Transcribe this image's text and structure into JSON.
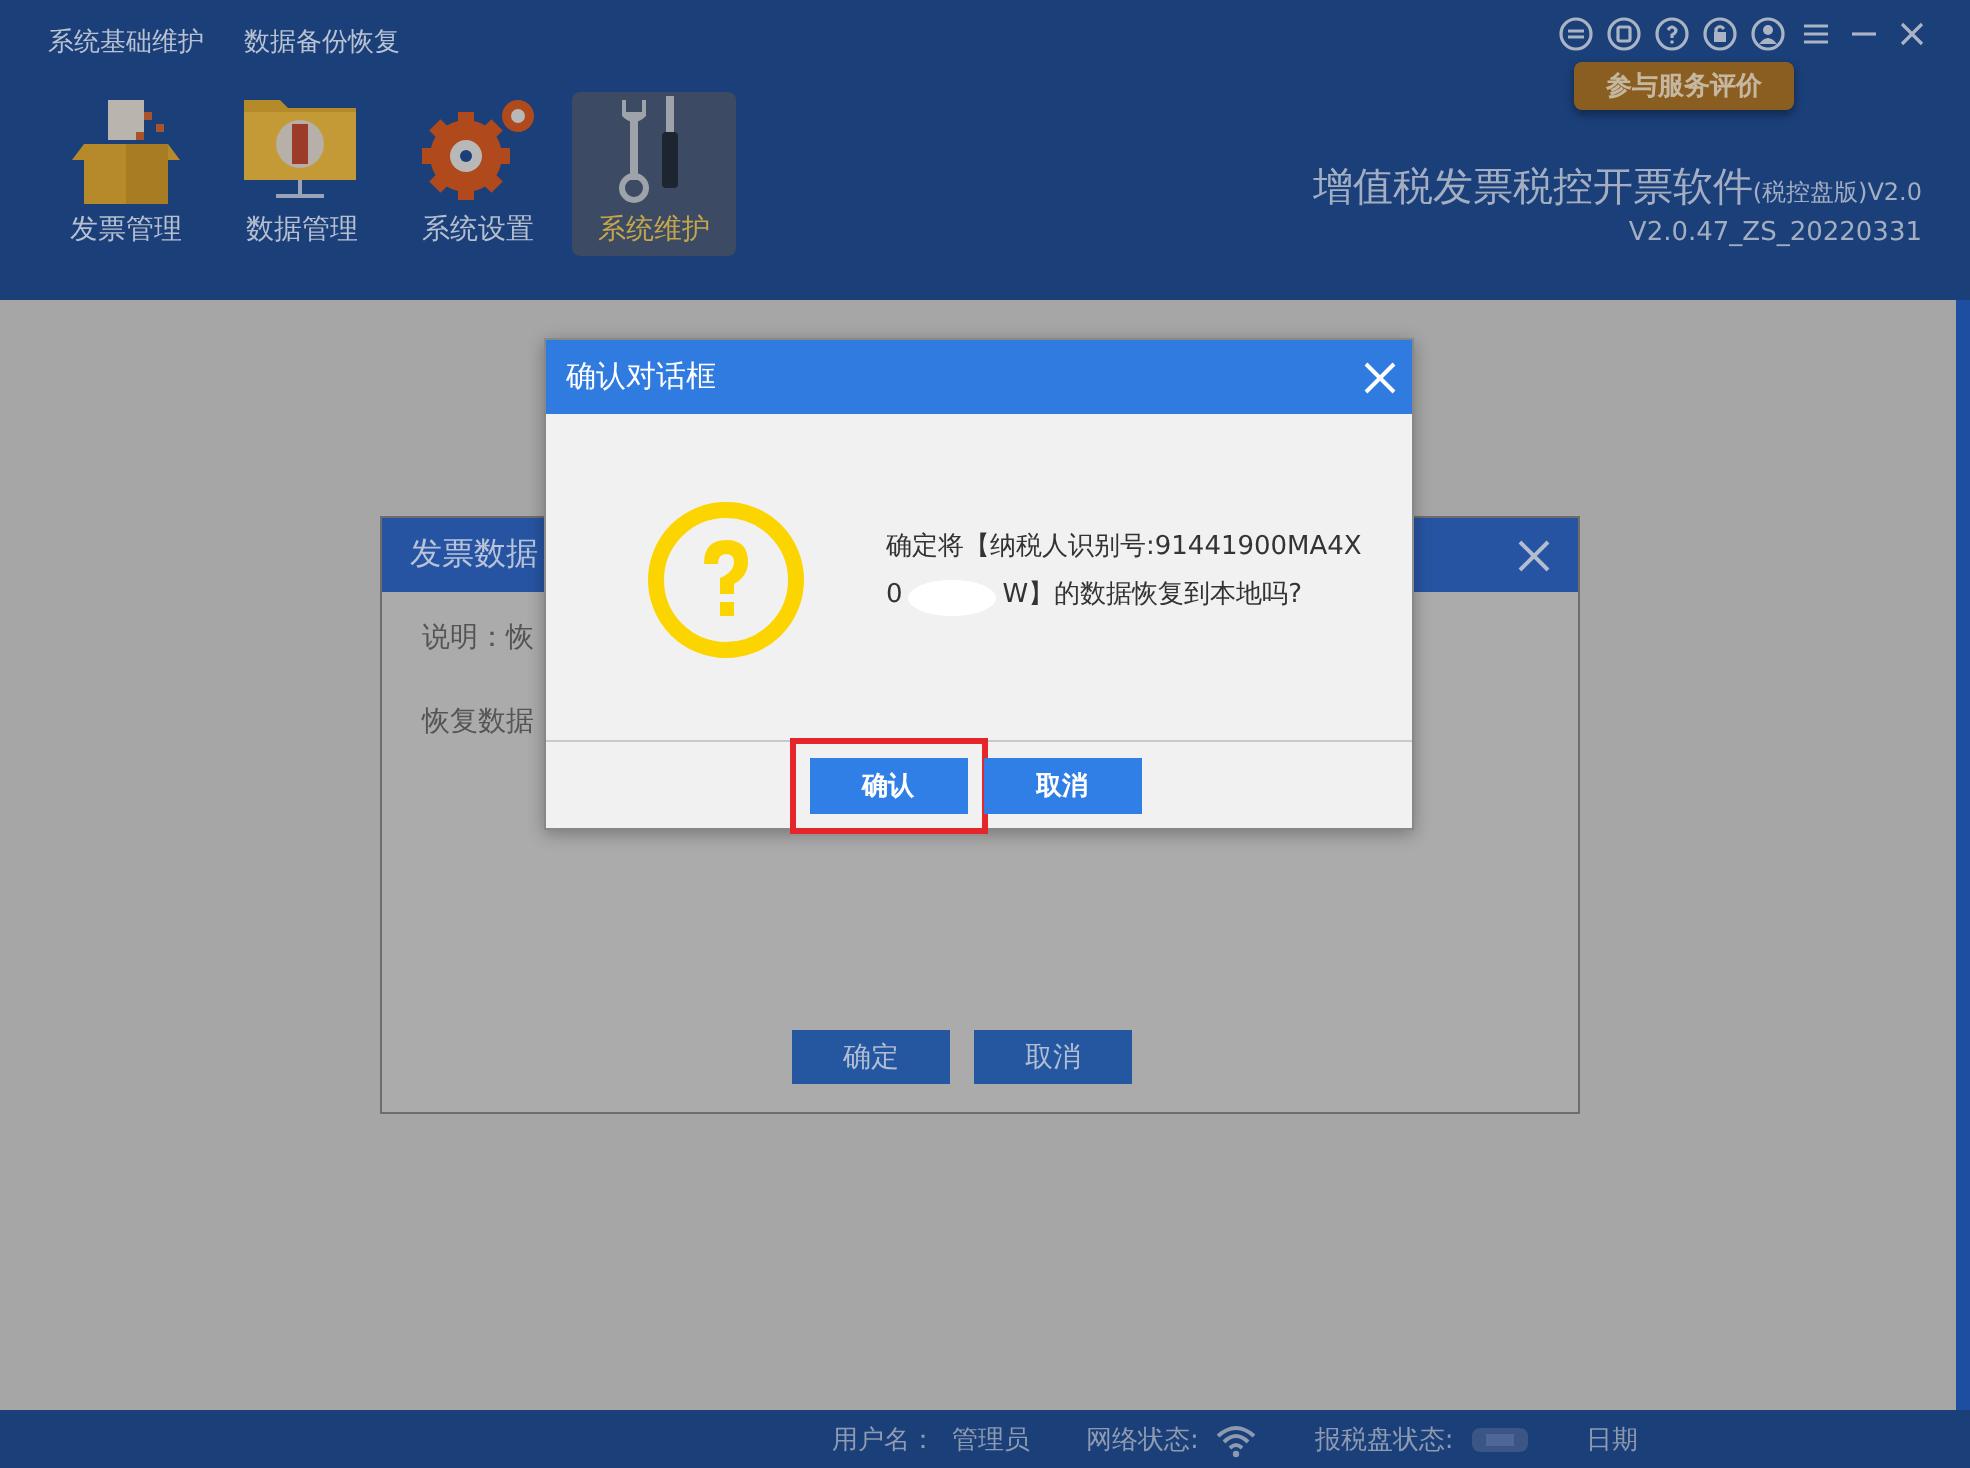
{
  "top_menu": [
    {
      "label": "系统基础维护"
    },
    {
      "label": "数据备份恢复"
    }
  ],
  "toolbar": [
    {
      "label": "发票管理",
      "kind": "box",
      "selected": false
    },
    {
      "label": "数据管理",
      "kind": "folder",
      "selected": false
    },
    {
      "label": "系统设置",
      "kind": "gear",
      "selected": false
    },
    {
      "label": "系统维护",
      "kind": "tools",
      "selected": true
    }
  ],
  "tooltip": "参与服务评价",
  "app_title": {
    "name": "增值税发票税控开票软件",
    "edition": "(税控盘版)V2.0",
    "build": "V2.0.47_ZS_20220331"
  },
  "background_dialog": {
    "title": "发票数据",
    "lines": [
      "说明：恢",
      "恢复数据"
    ],
    "buttons": [
      "确定",
      "取消"
    ]
  },
  "confirm_dialog": {
    "title": "确认对话框",
    "message_line_1": "确定将【纳税人识别号:91441900MA4X",
    "message_line_2_start": "0",
    "message_line_2_end": "W】的数据恢复到本地吗?",
    "buttons": [
      {
        "label": "确认",
        "highlighted": true
      },
      {
        "label": "取消",
        "highlighted": false
      }
    ]
  },
  "status_bar": {
    "user_label": "用户名：",
    "user": "管理员",
    "network_label": "网络状态:",
    "disk_label": "报税盘状态:",
    "date_label": "日期"
  }
}
